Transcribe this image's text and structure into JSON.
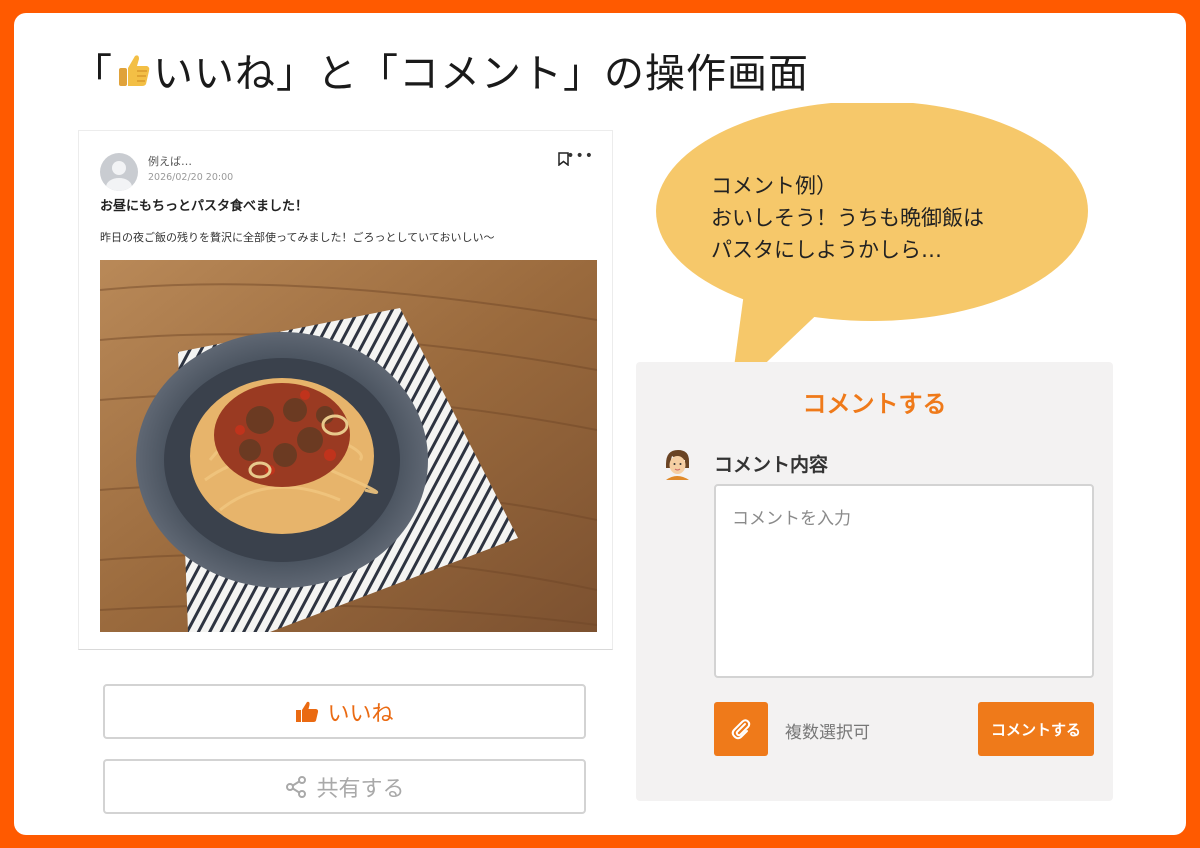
{
  "page": {
    "title_prefix": "「",
    "title_rest": "いいね」と「コメント」の操作画面"
  },
  "post": {
    "author": "例えば…",
    "date": "2026/02/20 20:00",
    "title": "お昼にもちっとパスタ食べました！",
    "body": "昨日の夜ご飯の残りを贅沢に全部使ってみました！ごろっとしていておいしい〜",
    "more_label": "•••"
  },
  "actions": {
    "like_label": "いいね",
    "share_label": "共有する"
  },
  "bubble": {
    "lines": [
      "コメント例）",
      "おいしそう！うちも晩御飯は",
      "パスタにしようかしら…"
    ]
  },
  "comment_form": {
    "heading": "コメントする",
    "field_label": "コメント内容",
    "placeholder": "コメントを入力",
    "attach_note": "複数選択可",
    "submit_label": "コメントする"
  },
  "colors": {
    "border_orange": "#ff5a00",
    "accent": "#ef7a1a",
    "bubble": "#f6c86a"
  }
}
